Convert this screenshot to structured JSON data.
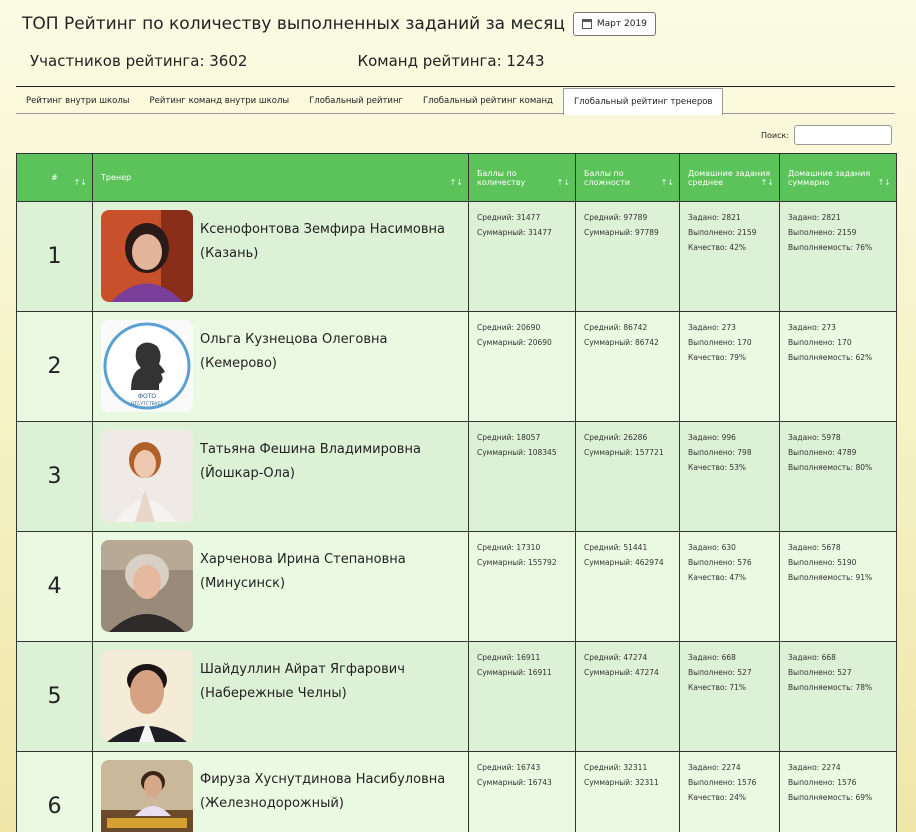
{
  "header": {
    "title": "ТОП Рейтинг по количеству выполненных заданий за месяц",
    "month": "Март 2019",
    "participants": "Участников рейтинга: 3602",
    "teams": "Команд рейтинга: 1243"
  },
  "tabs": [
    {
      "label": "Рейтинг внутри школы"
    },
    {
      "label": "Рейтинг команд внутри школы"
    },
    {
      "label": "Глобальный рейтинг"
    },
    {
      "label": "Глобальный рейтинг команд"
    },
    {
      "label": "Глобальный рейтинг тренеров"
    }
  ],
  "search": {
    "label": "Поиск:",
    "placeholder": ""
  },
  "columns": {
    "rank": "#",
    "trainer": "Тренер",
    "points_qty": "Баллы по количеству",
    "points_diff": "Баллы по сложности",
    "hw_avg": "Домашние задания среднее",
    "hw_sum": "Домашние задания суммарно"
  },
  "rows": [
    {
      "rank": "1",
      "name": "Ксенофонтова Земфира Насимовна",
      "city": "(Казань)",
      "q1": "Средний: 31477",
      "q2": "Суммарный: 31477",
      "d1": "Средний: 97789",
      "d2": "Суммарный: 97789",
      "a1": "Задано: 2821",
      "a2": "Выполнено: 2159",
      "a3": "Качество: 42%",
      "s1": "Задано: 2821",
      "s2": "Выполнено: 2159",
      "s3": "Выполняемость: 76%"
    },
    {
      "rank": "2",
      "name": "Ольга Кузнецова Олеговна",
      "city": "(Кемерово)",
      "q1": "Средний: 20690",
      "q2": "Суммарный: 20690",
      "d1": "Средний: 86742",
      "d2": "Суммарный: 86742",
      "a1": "Задано: 273",
      "a2": "Выполнено: 170",
      "a3": "Качество: 79%",
      "s1": "Задано: 273",
      "s2": "Выполнено: 170",
      "s3": "Выполняемость: 62%",
      "photo_text_1": "ФОТО",
      "photo_text_2": "ОТСУТСТВУЕТ"
    },
    {
      "rank": "3",
      "name": "Татьяна Фешина Владимировна",
      "city": "(Йошкар-Ола)",
      "q1": "Средний: 18057",
      "q2": "Суммарный: 108345",
      "d1": "Средний: 26286",
      "d2": "Суммарный: 157721",
      "a1": "Задано: 996",
      "a2": "Выполнено: 798",
      "a3": "Качество: 53%",
      "s1": "Задано: 5978",
      "s2": "Выполнено: 4789",
      "s3": "Выполняемость: 80%"
    },
    {
      "rank": "4",
      "name": "Харченова Ирина Степановна",
      "city": "(Минусинск)",
      "q1": "Средний: 17310",
      "q2": "Суммарный: 155792",
      "d1": "Средний: 51441",
      "d2": "Суммарный: 462974",
      "a1": "Задано: 630",
      "a2": "Выполнено: 576",
      "a3": "Качество: 47%",
      "s1": "Задано: 5678",
      "s2": "Выполнено: 5190",
      "s3": "Выполняемость: 91%"
    },
    {
      "rank": "5",
      "name": "Шайдуллин Айрат Ягфарович",
      "city": "(Набережные Челны)",
      "q1": "Средний: 16911",
      "q2": "Суммарный: 16911",
      "d1": "Средний: 47274",
      "d2": "Суммарный: 47274",
      "a1": "Задано: 668",
      "a2": "Выполнено: 527",
      "a3": "Качество: 71%",
      "s1": "Задано: 668",
      "s2": "Выполнено: 527",
      "s3": "Выполняемость: 78%"
    },
    {
      "rank": "6",
      "name": "Фируза Хуснутдинова Насибуловна",
      "city": "(Железнодорожный)",
      "q1": "Средний: 16743",
      "q2": "Суммарный: 16743",
      "d1": "Средний: 32311",
      "d2": "Суммарный: 32311",
      "a1": "Задано: 2274",
      "a2": "Выполнено: 1576",
      "a3": "Качество: 24%",
      "s1": "Задано: 2274",
      "s2": "Выполнено: 1576",
      "s3": "Выполняемость: 69%"
    }
  ]
}
